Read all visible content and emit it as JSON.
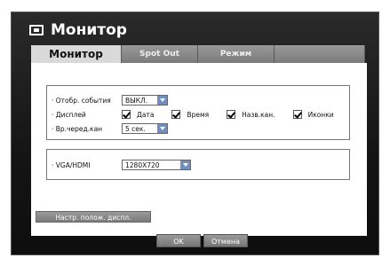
{
  "window": {
    "title": "Монитор",
    "icon": "monitor-icon"
  },
  "tabs": [
    {
      "label": "Монитор",
      "active": true
    },
    {
      "label": "Spot Out",
      "active": false
    },
    {
      "label": "Режим",
      "active": false
    },
    {
      "label": "",
      "active": false
    }
  ],
  "settings": {
    "event_display": {
      "label": "· Отобр. события",
      "value": "ВЫКЛ."
    },
    "display": {
      "label": "· Дисплей",
      "options": [
        {
          "label": "Дата",
          "checked": true
        },
        {
          "label": "Время",
          "checked": true
        },
        {
          "label": "Назв.кан.",
          "checked": true
        },
        {
          "label": "Иконки",
          "checked": true
        }
      ]
    },
    "seq_channel": {
      "label": "· Вр.черед.кан",
      "value": "5 сек."
    },
    "vga_hdmi": {
      "label": "· VGA/HDMI",
      "value": "1280X720"
    }
  },
  "buttons": {
    "display_position": "Настр. полож. диспл.",
    "ok": "OK",
    "cancel": "Отмена"
  },
  "colors": {
    "dropdown_arrow": "#6f8fc0",
    "window_bg": "#141414",
    "tab_active": "#d9d9d9"
  }
}
